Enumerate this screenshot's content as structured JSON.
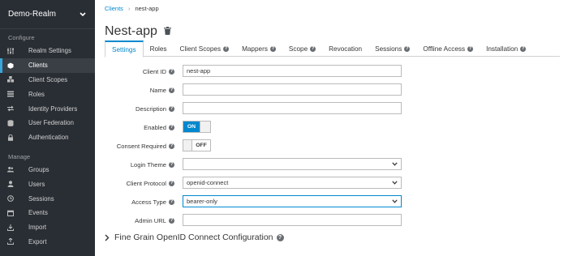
{
  "sidebar": {
    "realm": "Demo-Realm",
    "configure_label": "Configure",
    "manage_label": "Manage",
    "configure_items": [
      {
        "label": "Realm Settings",
        "icon": "sliders-icon"
      },
      {
        "label": "Clients",
        "icon": "cube-icon",
        "active": true
      },
      {
        "label": "Client Scopes",
        "icon": "cubes-icon"
      },
      {
        "label": "Roles",
        "icon": "list-icon"
      },
      {
        "label": "Identity Providers",
        "icon": "exchange-icon"
      },
      {
        "label": "User Federation",
        "icon": "database-icon"
      },
      {
        "label": "Authentication",
        "icon": "lock-icon"
      }
    ],
    "manage_items": [
      {
        "label": "Groups",
        "icon": "users-icon"
      },
      {
        "label": "Users",
        "icon": "user-icon"
      },
      {
        "label": "Sessions",
        "icon": "clock-icon"
      },
      {
        "label": "Events",
        "icon": "calendar-icon"
      },
      {
        "label": "Import",
        "icon": "import-icon"
      },
      {
        "label": "Export",
        "icon": "export-icon"
      }
    ]
  },
  "breadcrumb": {
    "parent": "Clients",
    "separator": "›",
    "current": "nest-app"
  },
  "page": {
    "title": "Nest-app"
  },
  "tabs": [
    {
      "label": "Settings",
      "help": false,
      "active": true
    },
    {
      "label": "Roles",
      "help": false
    },
    {
      "label": "Client Scopes",
      "help": true
    },
    {
      "label": "Mappers",
      "help": true
    },
    {
      "label": "Scope",
      "help": true
    },
    {
      "label": "Revocation",
      "help": false
    },
    {
      "label": "Sessions",
      "help": true
    },
    {
      "label": "Offline Access",
      "help": true
    },
    {
      "label": "Installation",
      "help": true
    }
  ],
  "form": {
    "client_id": {
      "label": "Client ID",
      "value": "nest-app"
    },
    "name": {
      "label": "Name",
      "value": ""
    },
    "description": {
      "label": "Description",
      "value": ""
    },
    "enabled": {
      "label": "Enabled",
      "state": "ON"
    },
    "consent_required": {
      "label": "Consent Required",
      "state": "OFF"
    },
    "login_theme": {
      "label": "Login Theme",
      "value": ""
    },
    "client_protocol": {
      "label": "Client Protocol",
      "value": "openid-connect"
    },
    "access_type": {
      "label": "Access Type",
      "value": "bearer-only"
    },
    "admin_url": {
      "label": "Admin URL",
      "value": ""
    }
  },
  "fine_grain": {
    "label": "Fine Grain OpenID Connect Configuration"
  },
  "colors": {
    "accent": "#0088ce",
    "sidebar_bg": "#292e34"
  }
}
